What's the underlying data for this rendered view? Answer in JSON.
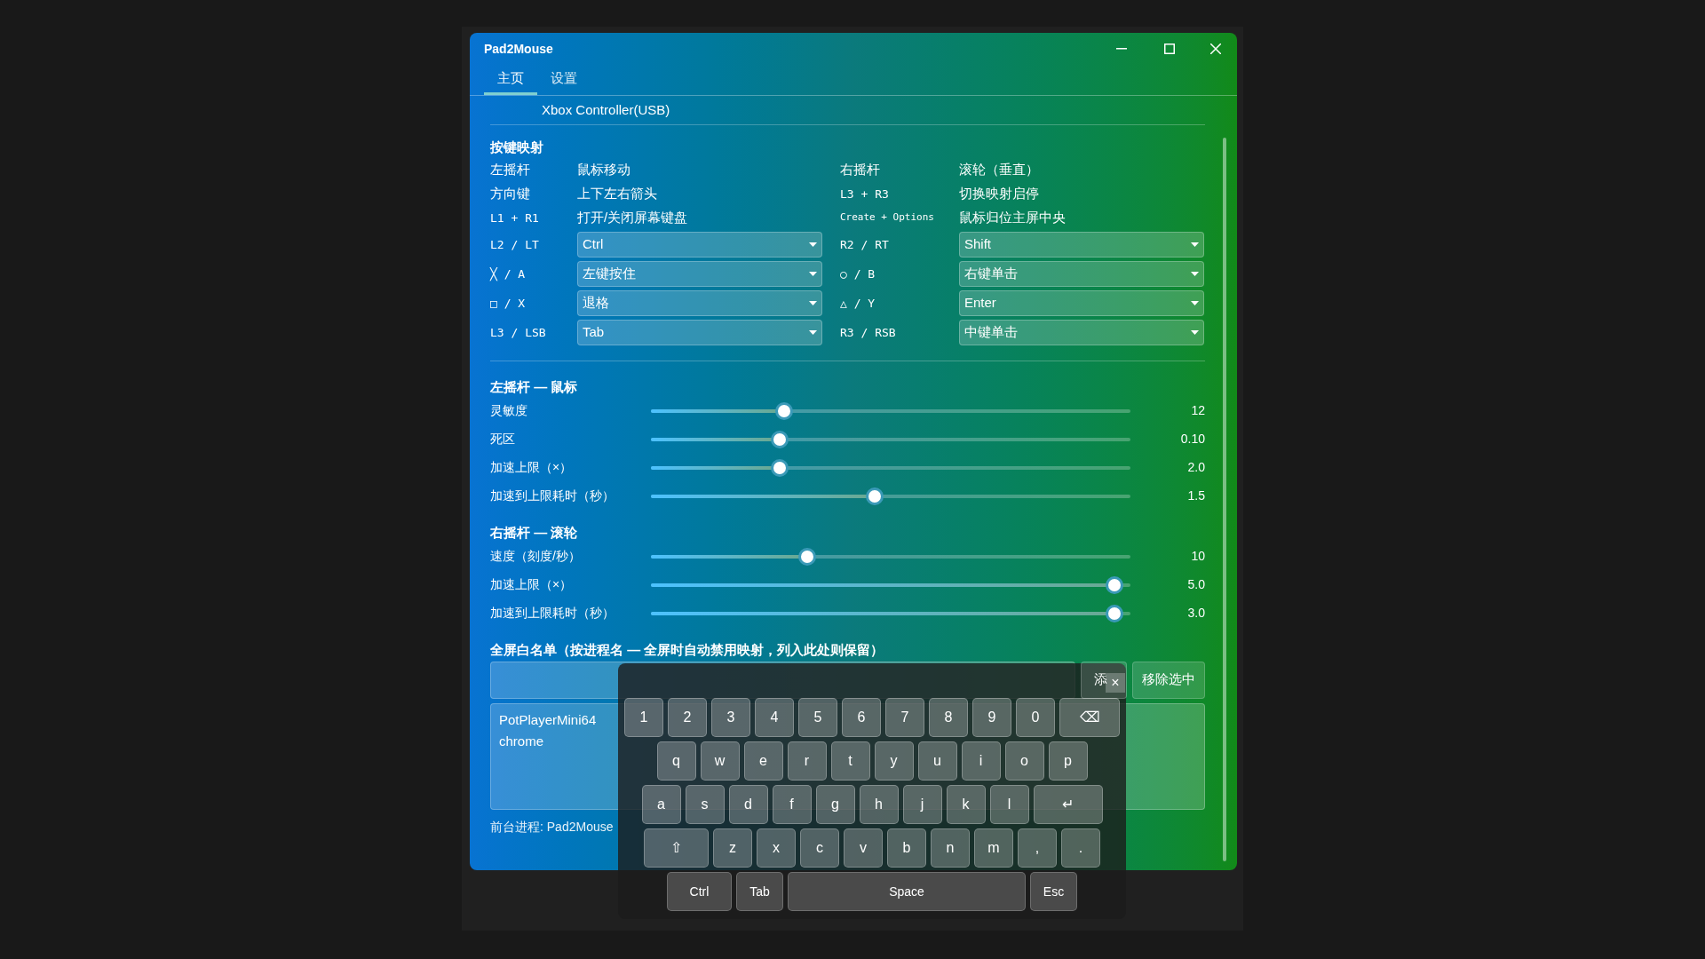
{
  "window": {
    "title": "Pad2Mouse"
  },
  "tabs": [
    {
      "label": "主页",
      "selected": true
    },
    {
      "label": "设置",
      "selected": false
    }
  ],
  "device": {
    "value": "Xbox Controller(USB)"
  },
  "mapping": {
    "title": "按键映射",
    "rows": [
      {
        "left": {
          "label": "左摇杆",
          "code": false,
          "compact": false,
          "kind": "text",
          "value": "鼠标移动"
        },
        "right": {
          "label": "右摇杆",
          "code": false,
          "compact": false,
          "kind": "text",
          "value": "滚轮（垂直）"
        }
      },
      {
        "left": {
          "label": "方向键",
          "code": false,
          "compact": false,
          "kind": "text",
          "value": "上下左右箭头"
        },
        "right": {
          "label": "L3 + R3",
          "code": true,
          "compact": false,
          "kind": "text",
          "value": "切换映射启停"
        }
      },
      {
        "left": {
          "label": "L1 + R1",
          "code": true,
          "compact": false,
          "kind": "text",
          "value": "打开/关闭屏幕键盘"
        },
        "right": {
          "label": "Create + Options",
          "code": true,
          "compact": true,
          "kind": "text",
          "value": "鼠标归位主屏中央"
        }
      },
      {
        "left": {
          "label": "L2 / LT",
          "code": true,
          "compact": false,
          "kind": "dropdown",
          "value": "Ctrl"
        },
        "right": {
          "label": "R2 / RT",
          "code": true,
          "compact": false,
          "kind": "dropdown",
          "value": "Shift"
        }
      },
      {
        "left": {
          "label": "╳ / A",
          "code": true,
          "compact": false,
          "kind": "dropdown",
          "value": "左键按住"
        },
        "right": {
          "label": "○ / B",
          "code": true,
          "compact": false,
          "kind": "dropdown",
          "value": "右键单击"
        }
      },
      {
        "left": {
          "label": "□ / X",
          "code": true,
          "compact": false,
          "kind": "dropdown",
          "value": "退格"
        },
        "right": {
          "label": "△ / Y",
          "code": true,
          "compact": false,
          "kind": "dropdown",
          "value": "Enter"
        }
      },
      {
        "left": {
          "label": "L3 / LSB",
          "code": true,
          "compact": false,
          "kind": "dropdown",
          "value": "Tab"
        },
        "right": {
          "label": "R3 / RSB",
          "code": true,
          "compact": false,
          "kind": "dropdown",
          "value": "中键单击"
        }
      }
    ]
  },
  "slider_groups": [
    {
      "title": "左摇杆 — 鼠标",
      "sliders": [
        {
          "label": "灵敏度",
          "level": 0.27,
          "reading": "12"
        },
        {
          "label": "死区",
          "level": 0.26,
          "reading": "0.10"
        },
        {
          "label": "加速上限（×）",
          "level": 0.26,
          "reading": "2.0"
        },
        {
          "label": "加速到上限耗时（秒）",
          "level": 0.465,
          "reading": "1.5"
        }
      ]
    },
    {
      "title": "右摇杆 — 滚轮",
      "sliders": [
        {
          "label": "速度（刻度/秒）",
          "level": 0.32,
          "reading": "10"
        },
        {
          "label": "加速上限（×）",
          "level": 0.985,
          "reading": "5.0"
        },
        {
          "label": "加速到上限耗时（秒）",
          "level": 0.985,
          "reading": "3.0"
        }
      ]
    }
  ],
  "whitelist": {
    "title": "全屏白名单（按进程名 — 全屏时自动禁用映射，列入此处则保留）",
    "buttons": [
      "添",
      "移除选中"
    ],
    "items": [
      "PotPlayerMini64",
      "chrome"
    ]
  },
  "status": [
    "前台进程: Pad2Mouse"
  ],
  "keyboard": {
    "close": "×",
    "rows": [
      {
        "keys": [
          {
            "label": "1"
          },
          {
            "label": "2"
          },
          {
            "label": "3"
          },
          {
            "label": "4"
          },
          {
            "label": "5"
          },
          {
            "label": "6"
          },
          {
            "label": "7"
          },
          {
            "label": "8"
          },
          {
            "label": "9"
          },
          {
            "label": "0"
          },
          {
            "label": "⌫",
            "kind": "wide"
          }
        ]
      },
      {
        "keys": [
          {
            "label": "q"
          },
          {
            "label": "w"
          },
          {
            "label": "e"
          },
          {
            "label": "r"
          },
          {
            "label": "t"
          },
          {
            "label": "y"
          },
          {
            "label": "u"
          },
          {
            "label": "i"
          },
          {
            "label": "o"
          },
          {
            "label": "p"
          }
        ]
      },
      {
        "keys": [
          {
            "label": "a"
          },
          {
            "label": "s"
          },
          {
            "label": "d"
          },
          {
            "label": "f"
          },
          {
            "label": "g"
          },
          {
            "label": "h"
          },
          {
            "label": "j"
          },
          {
            "label": "k"
          },
          {
            "label": "l"
          },
          {
            "label": "↵",
            "kind": "enter"
          }
        ]
      },
      {
        "keys": [
          {
            "label": "⇧",
            "kind": "shift"
          },
          {
            "label": "z"
          },
          {
            "label": "x"
          },
          {
            "label": "c"
          },
          {
            "label": "v"
          },
          {
            "label": "b"
          },
          {
            "label": "n"
          },
          {
            "label": "m"
          },
          {
            "label": ","
          },
          {
            "label": "."
          }
        ]
      }
    ],
    "bottom": [
      {
        "label": "Ctrl",
        "kind": "ctrl"
      },
      {
        "label": "Tab",
        "kind": "tab"
      },
      {
        "label": "Space",
        "kind": "space"
      },
      {
        "label": "Esc",
        "kind": "tab"
      }
    ]
  }
}
